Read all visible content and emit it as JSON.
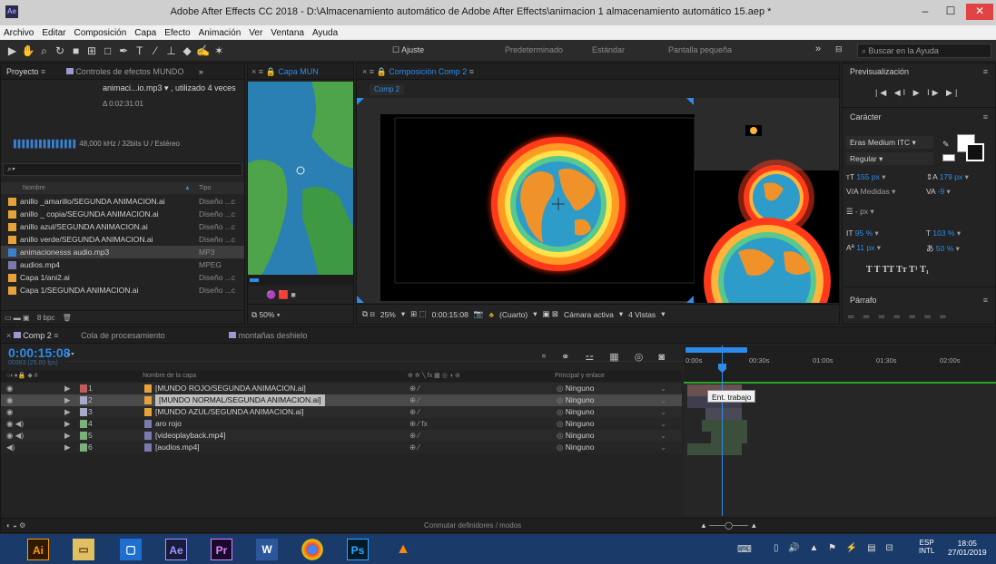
{
  "titlebar": {
    "app_icon": "Ae",
    "title": "Adobe After Effects CC 2018 - D:\\Almacenamiento automático de Adobe After Effects\\animacion 1 almacenamiento automático 15.aep *",
    "minimize": "–",
    "maximize": "☐",
    "close": "✕"
  },
  "menu": [
    "Archivo",
    "Editar",
    "Composición",
    "Capa",
    "Efecto",
    "Animación",
    "Ver",
    "Ventana",
    "Ayuda"
  ],
  "toolbar": {
    "snap_label": "Ajuste",
    "workspaces": [
      "Predeterminado",
      "Estándar",
      "Pantalla pequeña"
    ],
    "more": "»",
    "search_placeholder": "Buscar en la Ayuda"
  },
  "project": {
    "tab": "Proyecto",
    "tab2": "Controles de efectos MUNDO",
    "selected_name": "animaci...io.mp3 ▾ , utilizado 4 veces",
    "duration": "Δ 0:02:31:01",
    "audio_info": "48,000 kHz / 32bits U / Estéreo",
    "col_name": "Nombre",
    "col_type": "Tipo",
    "items": [
      {
        "name": "anillo _amarillo/SEGUNDA ANIMACION.ai",
        "type": "Diseño ...c"
      },
      {
        "name": "anillo _ copia/SEGUNDA ANIMACION.ai",
        "type": "Diseño ...c"
      },
      {
        "name": "anillo azul/SEGUNDA ANIMACION.ai",
        "type": "Diseño ...c"
      },
      {
        "name": "anillo verde/SEGUNDA ANIMACION.ai",
        "type": "Diseño ...c"
      },
      {
        "name": "animacionesss audio.mp3",
        "type": "MP3"
      },
      {
        "name": "audios.mp4",
        "type": "MPEG"
      },
      {
        "name": "Capa 1/ani2.ai",
        "type": "Diseño ...c"
      },
      {
        "name": "Capa 1/SEGUNDA ANIMACION.ai",
        "type": "Diseño ...c"
      }
    ],
    "bpc": "8 bpc"
  },
  "layer_viewer": {
    "tab": "Capa MUN",
    "zoom": "50%"
  },
  "comp_viewer": {
    "tab": "Composición Comp 2",
    "crumb": "Comp 2",
    "zoom": "25%",
    "time": "0:00:15:08",
    "resolution": "(Cuarto)",
    "camera": "Cámara activa",
    "views": "4 Vistas"
  },
  "preview": {
    "title": "Previsualización",
    "controls": "|◀ ◀I ▶ I▶ ▶|"
  },
  "character": {
    "title": "Carácter",
    "font": "Eras Medium ITC",
    "style": "Regular",
    "size": "155 px",
    "leading": "179 px",
    "kerning": "Medidas",
    "tracking": "-9",
    "stroke_width": "- px",
    "vscale": "95 %",
    "hscale": "103 %",
    "baseline": "11 px",
    "tsume": "50 %",
    "styles": "T  T  TT  Tт  T¹  T₁"
  },
  "paragraph": {
    "title": "Párrafo"
  },
  "timeline": {
    "tab": "Comp 2",
    "tab2": "Cola de procesamiento",
    "tab3": "montañas deshielo",
    "timecode": "0:00:15:08",
    "frames": "00383 (25.00 fps)",
    "col_layer": "Nombre de la capa",
    "col_parent": "Principal y enlace",
    "layers": [
      {
        "num": "1",
        "name": "[MUNDO ROJO/SEGUNDA ANIMACION.ai]",
        "parent": "Ninguno",
        "color": "#c45a5a"
      },
      {
        "num": "2",
        "name": "[MUNDO NORMAL/SEGUNDA ANIMACION.ai]",
        "parent": "Ninguno",
        "color": "#a8a8c8"
      },
      {
        "num": "3",
        "name": "[MUNDO AZUL/SEGUNDA ANIMACION.ai]",
        "parent": "Ninguno",
        "color": "#a8a8c8"
      },
      {
        "num": "4",
        "name": "aro rojo",
        "parent": "Ninguno",
        "color": "#7ab07a"
      },
      {
        "num": "5",
        "name": "[videoplayback.mp4]",
        "parent": "Ninguno",
        "color": "#7ab07a"
      },
      {
        "num": "6",
        "name": "[audios.mp4]",
        "parent": "Ninguno",
        "color": "#7ab07a"
      }
    ],
    "ruler": [
      "0:00s",
      "00:30s",
      "01:00s",
      "01:30s",
      "02:00s"
    ],
    "tooltip": "Ent. trabajo",
    "footer": "Conmutar definidores / modos"
  },
  "taskbar": {
    "apps": [
      "Ai",
      "",
      "",
      "Ae",
      "Pr",
      "W",
      "",
      "Ps",
      ""
    ],
    "lang": "ESP",
    "lang2": "INTL",
    "time": "18:05",
    "date": "27/01/2019"
  }
}
